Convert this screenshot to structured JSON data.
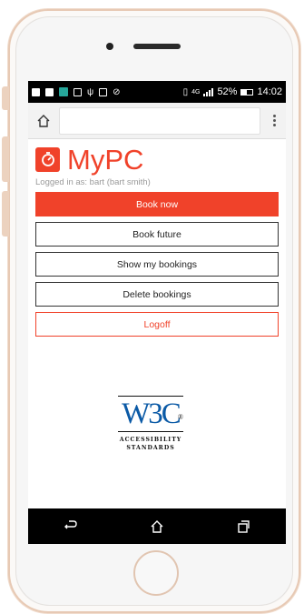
{
  "statusbar": {
    "battery_percent": "52%",
    "time": "14:02",
    "network": "4G",
    "icons": [
      "notification-icon",
      "mail-icon",
      "app-icon",
      "image-icon",
      "usb-icon",
      "image-icon",
      "mute-icon",
      "vibrate-icon",
      "signal-icon",
      "battery-icon"
    ]
  },
  "browser": {
    "url": "",
    "home_icon": "home-icon",
    "menu_icon": "more-vert-icon"
  },
  "app": {
    "name": "MyPC",
    "logged_in_text": "Logged in as: bart (bart smith)",
    "accent": "#f0422a"
  },
  "actions": {
    "book_now": "Book now",
    "book_future": "Book future",
    "show_bookings": "Show my bookings",
    "delete_bookings": "Delete bookings",
    "logoff": "Logoff"
  },
  "badge": {
    "text": "W3C",
    "registered": "®",
    "line1": "ACCESSIBILITY",
    "line2": "STANDARDS"
  },
  "navbar": {
    "icons": [
      "back-icon",
      "home-icon",
      "recents-icon"
    ]
  }
}
